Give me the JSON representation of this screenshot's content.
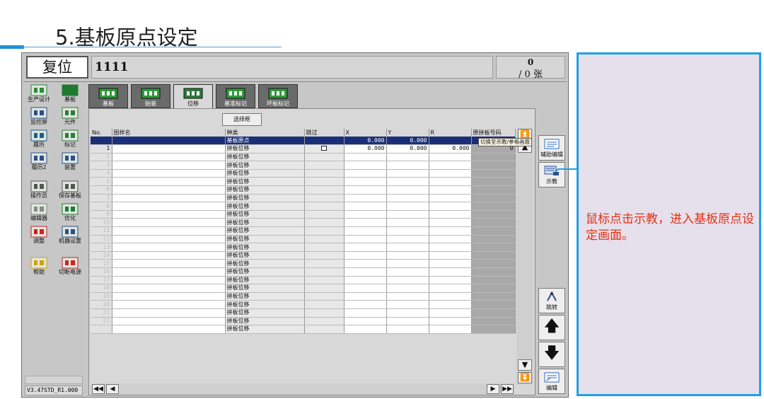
{
  "slide": {
    "title": "5.基板原点设定",
    "note": "鼠标点击示教，进入基板原点设定画面。"
  },
  "app": {
    "mode_label": "复位",
    "job_name": "1111",
    "count_top": "0",
    "count_bottom": "/ 0 张",
    "version": "V3.47STD_R1.000"
  },
  "left_menu": [
    {
      "label": "生产设计",
      "icon": "production-design-icon"
    },
    {
      "label": "基板",
      "icon": "board-icon"
    },
    {
      "label": "监控屏",
      "icon": "monitor-icon"
    },
    {
      "label": "元件",
      "icon": "component-icon"
    },
    {
      "label": "履历",
      "icon": "history-icon"
    },
    {
      "label": "标记",
      "icon": "mark-icon"
    },
    {
      "label": "履历2",
      "icon": "history2-icon"
    },
    {
      "label": "装置",
      "icon": "device-icon"
    },
    {
      "label": "操作员",
      "icon": "operator-icon"
    },
    {
      "label": "保存基板",
      "icon": "save-board-icon"
    },
    {
      "label": "编辑器",
      "icon": "editor-icon"
    },
    {
      "label": "优化",
      "icon": "optimize-icon"
    },
    {
      "label": "调整",
      "icon": "adjust-icon"
    },
    {
      "label": "机器设置",
      "icon": "machine-settings-icon"
    },
    {
      "label": "帮助",
      "icon": "help-icon"
    },
    {
      "label": "切断电源",
      "icon": "power-off-icon"
    }
  ],
  "tabs": [
    {
      "label": "基板",
      "active": false
    },
    {
      "label": "贴装",
      "active": false
    },
    {
      "label": "位移",
      "active": true
    },
    {
      "label": "基准标记",
      "active": false
    },
    {
      "label": "坏板标记",
      "active": false
    }
  ],
  "select_button": "选择框",
  "table": {
    "headers": [
      "No.",
      "图样名",
      "种类",
      "跳过",
      "X",
      "Y",
      "R",
      "原拼板号码"
    ],
    "rows": [
      {
        "no": "",
        "name": "",
        "kind": "基板原点",
        "skip": false,
        "x": "0.000",
        "y": "0.000",
        "r": "",
        "orig": "",
        "selected": true
      },
      {
        "no": "1",
        "name": "",
        "kind": "拼板位移",
        "skip": true,
        "x": "0.000",
        "y": "0.000",
        "r": "0.000",
        "orig": "0"
      },
      {
        "no": "2",
        "name": "",
        "kind": "拼板位移"
      },
      {
        "no": "3",
        "name": "",
        "kind": "拼板位移"
      },
      {
        "no": "4",
        "name": "",
        "kind": "拼板位移"
      },
      {
        "no": "5",
        "name": "",
        "kind": "拼板位移"
      },
      {
        "no": "6",
        "name": "",
        "kind": "拼板位移"
      },
      {
        "no": "7",
        "name": "",
        "kind": "拼板位移"
      },
      {
        "no": "8",
        "name": "",
        "kind": "拼板位移"
      },
      {
        "no": "9",
        "name": "",
        "kind": "拼板位移"
      },
      {
        "no": "10",
        "name": "",
        "kind": "拼板位移"
      },
      {
        "no": "11",
        "name": "",
        "kind": "拼板位移"
      },
      {
        "no": "12",
        "name": "",
        "kind": "拼板位移"
      },
      {
        "no": "13",
        "name": "",
        "kind": "拼板位移"
      },
      {
        "no": "14",
        "name": "",
        "kind": "拼板位移"
      },
      {
        "no": "15",
        "name": "",
        "kind": "拼板位移"
      },
      {
        "no": "16",
        "name": "",
        "kind": "拼板位移"
      },
      {
        "no": "17",
        "name": "",
        "kind": "拼板位移"
      },
      {
        "no": "18",
        "name": "",
        "kind": "拼板位移"
      },
      {
        "no": "19",
        "name": "",
        "kind": "拼板位移"
      },
      {
        "no": "20",
        "name": "",
        "kind": "拼板位移"
      },
      {
        "no": "21",
        "name": "",
        "kind": "拼板位移"
      },
      {
        "no": "22",
        "name": "",
        "kind": "拼板位移"
      },
      {
        "no": "",
        "name": "",
        "kind": "拼板位移"
      }
    ]
  },
  "right_panel": {
    "aux_edit": "辅助编辑",
    "teach": "示教",
    "tooltip": "切换至示教/参格画面",
    "jump": "跳转",
    "edit": "编辑"
  },
  "colors": {
    "selected_row": "#1a2f78",
    "accent": "#1ea0e6",
    "note_text": "#e53012",
    "note_bg": "#e6e0ec"
  }
}
